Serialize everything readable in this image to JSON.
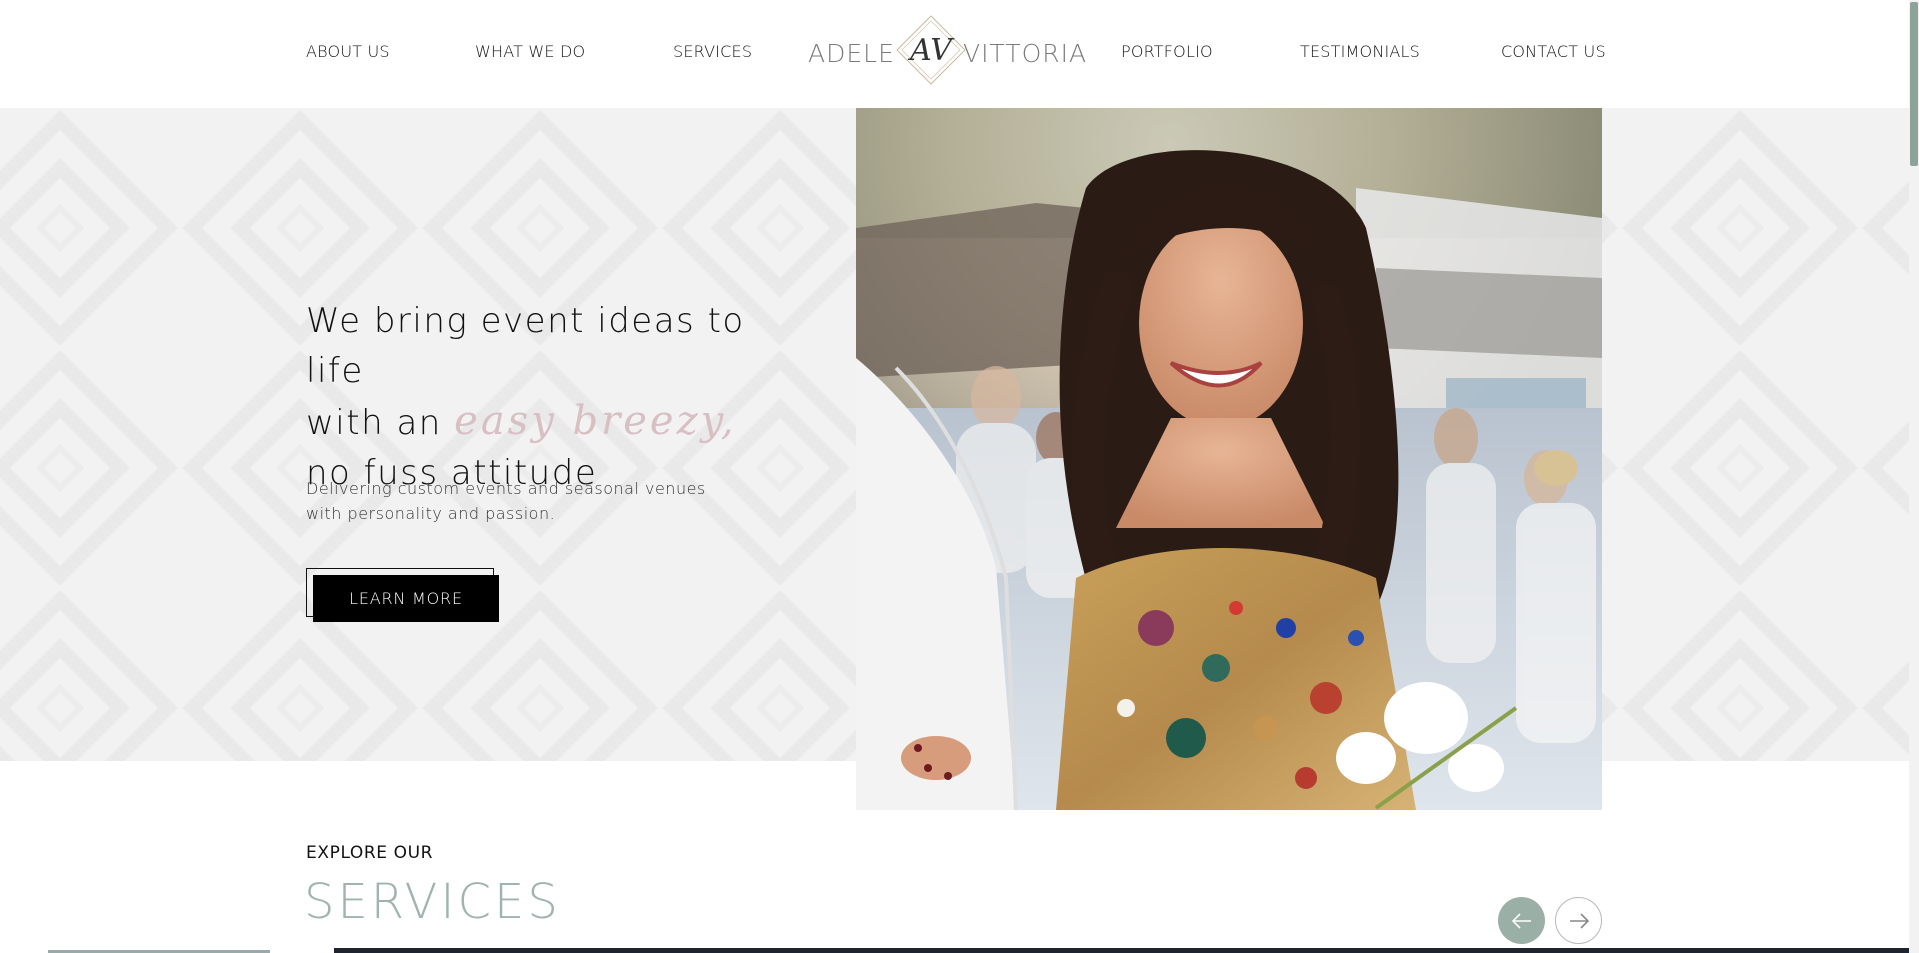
{
  "nav": {
    "left": [
      "ABOUT US",
      "WHAT WE DO",
      "SERVICES"
    ],
    "right": [
      "PORTFOLIO",
      "TESTIMONIALS",
      "CONTACT US"
    ],
    "logo": {
      "first": "ADELE",
      "monogram": "AV",
      "last": "VITTORIA"
    }
  },
  "hero": {
    "line1": "We bring event ideas to life",
    "line2_prefix": "with an",
    "line2_script": "easy breezy,",
    "line3": "no fuss attitude",
    "subtext": "Delivering custom events and seasonal venues with personality and passion.",
    "button_label": "LEARN MORE",
    "image_icon": "hero-photo-icon"
  },
  "services": {
    "kicker": "EXPLORE OUR",
    "title": "SERVICES",
    "prev_icon": "arrow-left-icon",
    "next_icon": "arrow-right-icon"
  },
  "colors": {
    "accent_sage": "#9fb5ab",
    "script_pink": "#d8bfc4",
    "hero_bg": "#f2f2f2",
    "button_bg": "#000000"
  }
}
